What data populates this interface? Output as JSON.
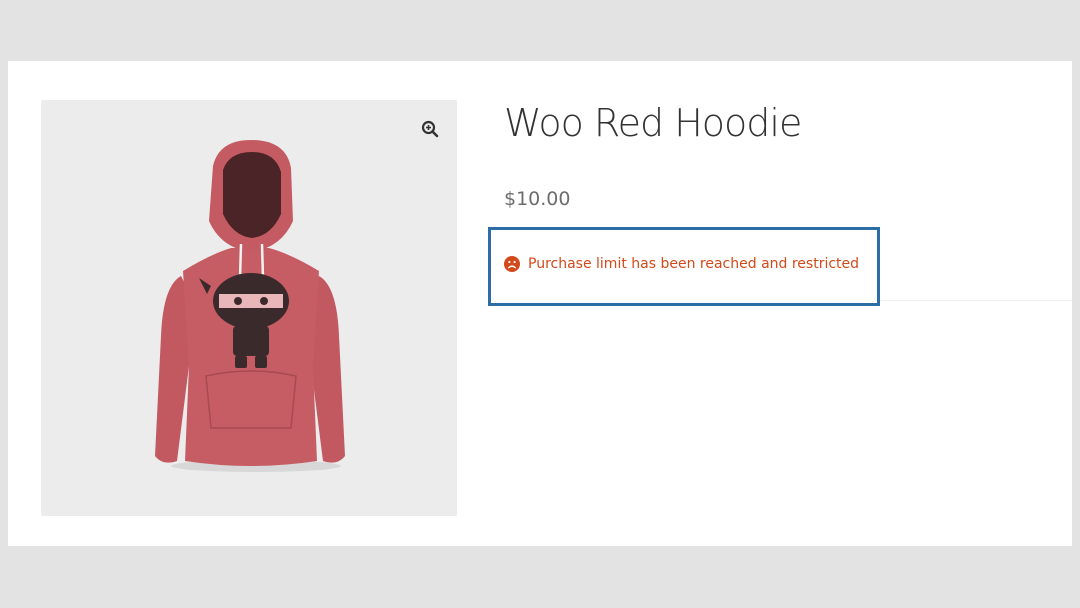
{
  "product": {
    "title": "Woo Red Hoodie",
    "price": "$10.00",
    "image_alt": "Woo Red Hoodie",
    "zoom_icon": "magnifier-plus-icon"
  },
  "notice": {
    "message": "Purchase limit has been reached and restricted",
    "icon": "sad-face-icon",
    "color": "#d2491a",
    "highlight_border_color": "#2d6da6"
  },
  "colors": {
    "page_background": "#e4e3e4",
    "card_background": "#ffffff",
    "gallery_background": "#ececec",
    "hoodie": "#c55b62",
    "title_text": "#333333",
    "price_text": "#6d6d6d"
  }
}
